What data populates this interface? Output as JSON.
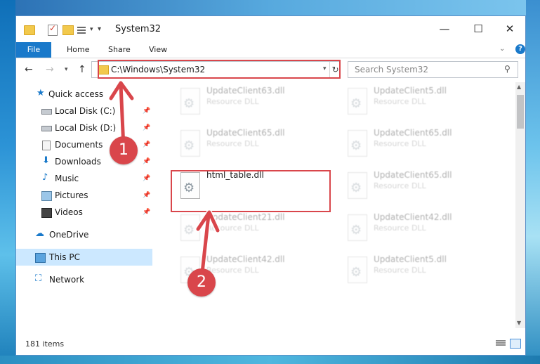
{
  "window": {
    "title": "System32"
  },
  "ribbon": {
    "tabs": [
      {
        "label": "File"
      },
      {
        "label": "Home"
      },
      {
        "label": "Share"
      },
      {
        "label": "View"
      }
    ]
  },
  "address": {
    "path": "C:\\Windows\\System32"
  },
  "search": {
    "placeholder": "Search System32"
  },
  "sidebar": {
    "items": [
      {
        "label": "Quick access"
      },
      {
        "label": "Local Disk (C:)"
      },
      {
        "label": "Local Disk (D:)"
      },
      {
        "label": "Documents"
      },
      {
        "label": "Downloads"
      },
      {
        "label": "Music"
      },
      {
        "label": "Pictures"
      },
      {
        "label": "Videos"
      },
      {
        "label": "OneDrive"
      },
      {
        "label": "This PC"
      },
      {
        "label": "Network"
      }
    ]
  },
  "files": [
    {
      "name": "UpdateClient63.dll",
      "type": "Resource DLL"
    },
    {
      "name": "UpdateClient5.dll",
      "type": "Resource DLL"
    },
    {
      "name": "UpdateClient65.dll",
      "type": "Resource DLL"
    },
    {
      "name": "UpdateClient65.dll",
      "type": "Resource DLL"
    },
    {
      "name": "html_table.dll",
      "type": ""
    },
    {
      "name": "UpdateClient65.dll",
      "type": "Resource DLL"
    },
    {
      "name": "UpdateClient21.dll",
      "type": "Resource DLL"
    },
    {
      "name": "UpdateClient42.dll",
      "type": "Resource DLL"
    },
    {
      "name": "UpdateClient42.dll",
      "type": "Resource DLL"
    },
    {
      "name": "UpdateClient5.dll",
      "type": "Resource DLL"
    }
  ],
  "status": {
    "item_count": "181 items"
  },
  "annotations": {
    "step1": "1",
    "step2": "2"
  },
  "colors": {
    "accent": "#1979ca",
    "highlight": "#d9464b",
    "selected_bg": "#cce8ff"
  }
}
